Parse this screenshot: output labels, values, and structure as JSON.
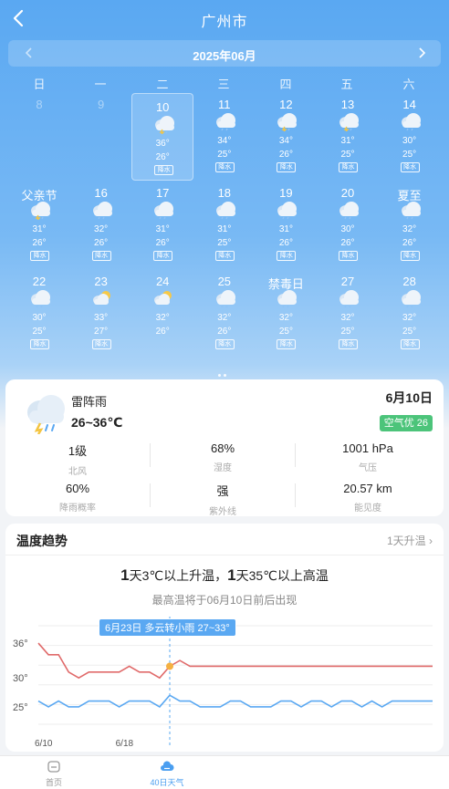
{
  "header": {
    "title": "广州市"
  },
  "month_bar": {
    "label": "2025年06月"
  },
  "weekdays": [
    "日",
    "一",
    "二",
    "三",
    "四",
    "五",
    "六"
  ],
  "days": [
    {
      "label": "8",
      "hi": "",
      "lo": "",
      "badge": "",
      "past": true
    },
    {
      "label": "9",
      "hi": "",
      "lo": "",
      "badge": "",
      "past": true
    },
    {
      "label": "10",
      "hi": "36°",
      "lo": "26°",
      "badge": "降水",
      "icon": "thunder-rain-icon",
      "selected": true
    },
    {
      "label": "11",
      "hi": "34°",
      "lo": "25°",
      "badge": "降水",
      "icon": "cloudy-rain-icon"
    },
    {
      "label": "12",
      "hi": "34°",
      "lo": "26°",
      "badge": "降水",
      "icon": "thunder-rain-icon"
    },
    {
      "label": "13",
      "hi": "31°",
      "lo": "25°",
      "badge": "降水",
      "icon": "thunder-rain-icon"
    },
    {
      "label": "14",
      "hi": "30°",
      "lo": "25°",
      "badge": "降水",
      "icon": "cloudy-rain-icon"
    },
    {
      "label": "父亲节",
      "hi": "31°",
      "lo": "26°",
      "badge": "降水",
      "icon": "thunder-rain-icon"
    },
    {
      "label": "16",
      "hi": "32°",
      "lo": "26°",
      "badge": "降水",
      "icon": "cloudy-rain-icon"
    },
    {
      "label": "17",
      "hi": "31°",
      "lo": "26°",
      "badge": "降水",
      "icon": "cloudy-rain-icon"
    },
    {
      "label": "18",
      "hi": "31°",
      "lo": "25°",
      "badge": "降水",
      "icon": "cloudy-rain-icon"
    },
    {
      "label": "19",
      "hi": "31°",
      "lo": "26°",
      "badge": "降水",
      "icon": "cloudy-rain-icon"
    },
    {
      "label": "20",
      "hi": "30°",
      "lo": "26°",
      "badge": "降水",
      "icon": "cloudy-rain-icon"
    },
    {
      "label": "夏至",
      "hi": "32°",
      "lo": "26°",
      "badge": "降水",
      "icon": "cloudy-rain-icon"
    },
    {
      "label": "22",
      "hi": "30°",
      "lo": "25°",
      "badge": "降水",
      "icon": "cloudy-rain-icon"
    },
    {
      "label": "23",
      "hi": "33°",
      "lo": "27°",
      "badge": "降水",
      "icon": "partly-cloudy-icon"
    },
    {
      "label": "24",
      "hi": "32°",
      "lo": "26°",
      "badge": "",
      "icon": "partly-cloudy-icon"
    },
    {
      "label": "25",
      "hi": "32°",
      "lo": "26°",
      "badge": "降水",
      "icon": "cloudy-rain-icon"
    },
    {
      "label": "禁毒日",
      "hi": "32°",
      "lo": "25°",
      "badge": "降水",
      "icon": "cloudy-rain-icon"
    },
    {
      "label": "27",
      "hi": "32°",
      "lo": "25°",
      "badge": "降水",
      "icon": "cloudy-rain-icon"
    },
    {
      "label": "28",
      "hi": "32°",
      "lo": "25°",
      "badge": "降水",
      "icon": "cloudy-rain-icon"
    }
  ],
  "detail": {
    "condition": "雷阵雨",
    "temp_range": "26~36℃",
    "date": "6月10日",
    "aqi": "空气优 26",
    "stats": [
      {
        "value": "1级",
        "label": "北风"
      },
      {
        "value": "68%",
        "label": "湿度"
      },
      {
        "value": "1001 hPa",
        "label": "气压"
      },
      {
        "value": "60%",
        "label": "降雨概率"
      },
      {
        "value": "强",
        "label": "紫外线"
      },
      {
        "value": "20.57 km",
        "label": "能见度"
      }
    ]
  },
  "trend": {
    "title": "温度趋势",
    "link": "1天升温 ›",
    "headline_n1": "1",
    "headline_t1": "天3℃以上升温，",
    "headline_n2": "1",
    "headline_t2": "天35℃以上高温",
    "subtitle": "最高温将于06月10日前后出现",
    "tooltip": "6月23日 多云转小雨 27~33°"
  },
  "chart_data": {
    "type": "line",
    "y_tick_labels": [
      "36°",
      "30°",
      "25°"
    ],
    "yticks": [
      36,
      30,
      25
    ],
    "ylim": [
      22,
      39
    ],
    "x_tick_labels": [
      "6/10",
      "6/18"
    ],
    "x_ticks": [
      0,
      8
    ],
    "highlight_index": 13,
    "x": [
      0,
      1,
      2,
      3,
      4,
      5,
      6,
      7,
      8,
      9,
      10,
      11,
      12,
      13,
      14,
      15,
      16,
      17,
      18,
      19,
      20,
      21,
      22,
      23,
      24,
      25,
      26,
      27,
      28,
      29,
      30,
      31,
      32,
      33,
      34,
      35,
      36,
      37,
      38,
      39
    ],
    "series": [
      {
        "color": "#e06a6a",
        "values": [
          36,
          34,
          34,
          31,
          30,
          31,
          31,
          31,
          31,
          32,
          31,
          31,
          30,
          32,
          33,
          32,
          32,
          32,
          32,
          32,
          32,
          32,
          32,
          32,
          32,
          32,
          32,
          32,
          32,
          32,
          32,
          32,
          32,
          32,
          32,
          32,
          32,
          32,
          32,
          32
        ]
      },
      {
        "color": "#5aa8f2",
        "values": [
          26,
          25,
          26,
          25,
          25,
          26,
          26,
          26,
          25,
          26,
          26,
          26,
          25,
          27,
          26,
          26,
          25,
          25,
          25,
          26,
          26,
          25,
          25,
          25,
          26,
          26,
          25,
          26,
          26,
          25,
          26,
          26,
          25,
          26,
          25,
          26,
          26,
          26,
          26,
          26
        ]
      }
    ]
  },
  "bottom_nav": [
    {
      "label": "首页",
      "icon": "home-icon"
    },
    {
      "label": "40日天气",
      "icon": "cloud-icon",
      "active": true
    },
    {
      "label": "",
      "icon": ""
    },
    {
      "label": "",
      "icon": ""
    },
    {
      "label": "",
      "icon": ""
    }
  ],
  "colors": {
    "accent": "#4a9ef0",
    "hi_line": "#e06a6a",
    "lo_line": "#5aa8f2",
    "aqi_good": "#4cc47a"
  }
}
